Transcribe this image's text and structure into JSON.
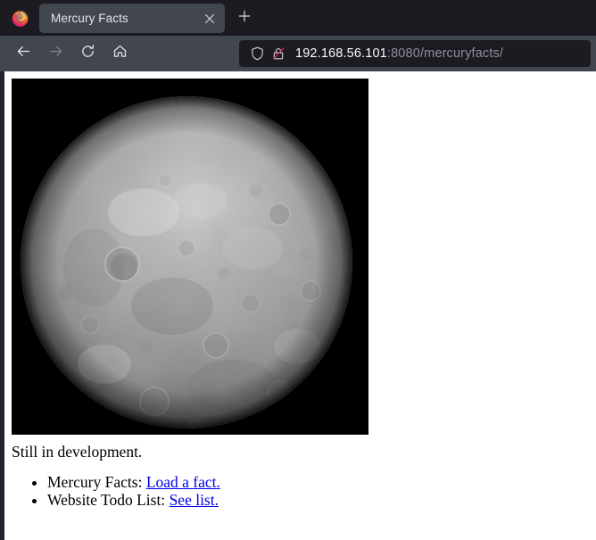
{
  "browser": {
    "app_logo_icon": "firefox-logo",
    "tabs": [
      {
        "title": "Mercury Facts",
        "close_icon": "close-icon",
        "active": true
      }
    ],
    "new_tab_label": "+",
    "new_tab_icon": "plus-icon",
    "toolbar": {
      "back_icon": "back-arrow-icon",
      "forward_icon": "forward-arrow-icon",
      "reload_icon": "reload-icon",
      "home_icon": "home-icon"
    },
    "address_bar": {
      "shield_icon": "shield-icon",
      "lock_icon": "broken-lock-icon",
      "url_host": "192.168.56.101",
      "url_rest": ":8080/mercuryfacts/",
      "full_url": "192.168.56.101:8080/mercuryfacts/"
    },
    "colors": {
      "tabstrip_bg": "#1c1b22",
      "toolbar_bg": "#42464f",
      "active_tab_bg": "#42464f",
      "urlbar_bg": "#1c1b22",
      "text": "#fbfbfe",
      "dim_text": "#8f8f9d",
      "link": "#0000ee",
      "insecure_red": "#e22850"
    }
  },
  "page": {
    "hero_image_alt": "mercury-planet-photo",
    "status_text": "Still in development.",
    "list": [
      {
        "label": "Mercury Facts:",
        "link_text": "Load a fact."
      },
      {
        "label": "Website Todo List:",
        "link_text": "See list."
      }
    ]
  }
}
